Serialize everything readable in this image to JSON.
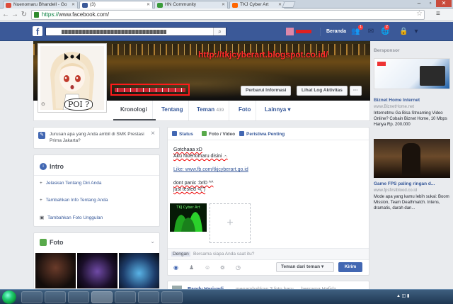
{
  "browser": {
    "tabs": [
      {
        "title": "Nuenomaru Bhandell - Go",
        "favicon_color": "#dd4b39"
      },
      {
        "title": "(3)",
        "favicon_color": "#3b5998"
      },
      {
        "title": "HN Community",
        "favicon_color": "#3a9b3a"
      },
      {
        "title": "TKJ Cyber Art",
        "favicon_color": "#ff6600"
      }
    ],
    "url_scheme": "https://",
    "url_host": "www.facebook.com/"
  },
  "fb": {
    "logo": "f",
    "home_label": "Beranda",
    "friend_badge": "1",
    "notif_badge": "2"
  },
  "cover": {
    "watermark": "http://tkjcyberart.blogspot.co.id/",
    "update_info": "Perbarui Informasi",
    "activity_log": "Lihat Log Aktivitas",
    "more": "···"
  },
  "profile": {
    "poi_text": "POI ?"
  },
  "profile_tabs": [
    {
      "label": "Kronologi"
    },
    {
      "label": "Tentang"
    },
    {
      "label": "Teman",
      "count": "439"
    },
    {
      "label": "Foto"
    },
    {
      "label": "Lainnya ▾"
    }
  ],
  "question_card": {
    "text": "Jurusan apa yang Anda ambil di SMK Prestasi Prima Jakarta?",
    "close": "×"
  },
  "intro": {
    "title": "Intro",
    "links": [
      {
        "icon": "+",
        "label": "Jelaskan Tentang Diri Anda"
      },
      {
        "icon": "+",
        "label": "Tambahkan Info Tentang Anda"
      },
      {
        "icon": "▣",
        "label": "Tambahkan Foto Unggulan"
      }
    ]
  },
  "photos": {
    "title": "Foto"
  },
  "composer": {
    "tabs": [
      "Status",
      "Foto / Video",
      "Peristiwa Penting"
    ],
    "lines": [
      "Gotchaaa xD",
      "Aku Nuenomaru disini .-.",
      "",
      "Like: www.fb.com/tkjcyberart.go.id",
      "",
      "dont panic :brl0 ^^",
      "just tested <(\")"
    ],
    "with_label": "Dengan",
    "with_placeholder": "Bersama siapa Anda saat itu?",
    "audience": "Teman dari teman ▾",
    "submit": "Kirim",
    "add_photo": "+"
  },
  "next_post": {
    "author": "Randy Hariyadi",
    "text": "menambahkan 3 foto baru — bersama Hafidz"
  },
  "sponsor": {
    "heading": "Bersponsor",
    "ads": [
      {
        "title": "Biznet Home Internet",
        "link": "www.BiznetHome.net",
        "text": "Internetmu Ga Bisa Streaming Video Online? Cobain Biznet Home, 10 Mbps Hanya Rp. 200.000"
      },
      {
        "title": "Game FPS paling ringan d...",
        "link": "www.fpsfirstblood.co.id",
        "text": "Mode apa yang kamu lebih sukai: Boom Mission, Team Deathmatch. Intens, dramatis, darah dan..."
      }
    ]
  }
}
